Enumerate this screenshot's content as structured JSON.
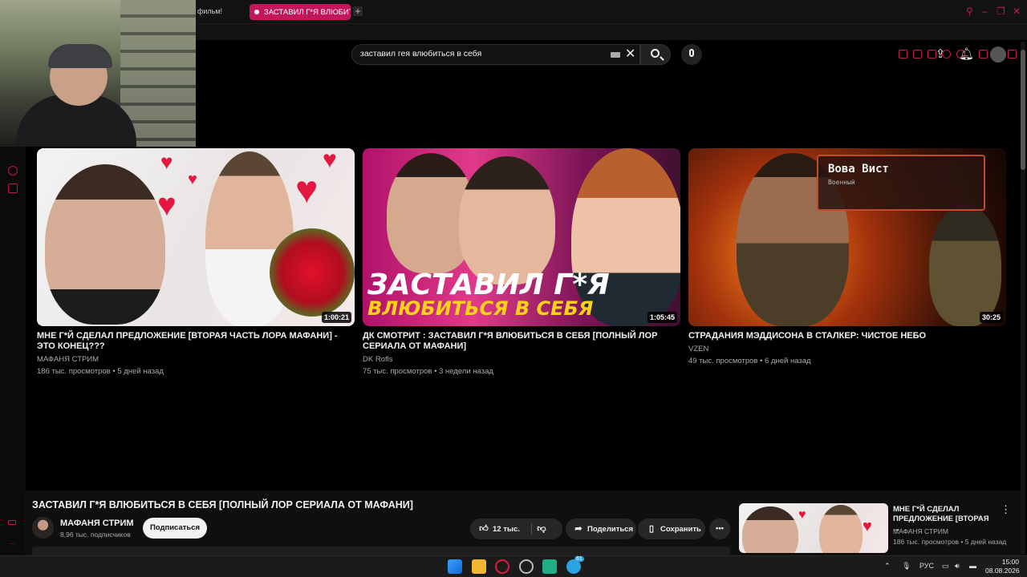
{
  "browser": {
    "prev_tab_label": "фильм!",
    "active_tab_label": "ЗАСТАВИЛ Г*Я ВЛЮБИТЬ",
    "accent_color": "#c2185b"
  },
  "header": {
    "search_value": "заставил гея влюбиться в себя",
    "icons": [
      "keyboard-icon",
      "clear-icon",
      "search-icon",
      "mic-icon",
      "upload-icon",
      "bell-icon",
      "avatar"
    ]
  },
  "videos": [
    {
      "title": "МНЕ Г*Й СДЕЛАЛ ПРЕДЛОЖЕНИЕ [ВТОРАЯ ЧАСТЬ ЛОРА МАФАНИ] - ЭТО КОНЕЦ???",
      "channel": "МАФАНЯ СТРИМ",
      "meta": "186 тыс. просмотров • 5 дней назад",
      "duration": "1:00:21"
    },
    {
      "title": "ДК СМОТРИТ : ЗАСТАВИЛ Г*Я ВЛЮБИТЬСЯ В СЕБЯ [ПОЛНЫЙ ЛОР СЕРИАЛА ОТ МАФАНИ]",
      "channel": "DK Rofls",
      "meta": "75 тыс. просмотров • 3 недели назад",
      "duration": "1:05:45",
      "thumb_text_line1": "ЗАСТАВИЛ Г*Я",
      "thumb_text_line2": "ВЛЮБИТЬСЯ В СЕБЯ"
    },
    {
      "title": "СТРАДАНИЯ МЭДДИСОНА В СТАЛКЕР: ЧИСТОЕ НЕБО",
      "channel": "VZEN",
      "meta": "49 тыс. просмотров • 6 дней назад",
      "duration": "30:25",
      "thumb_badge_name": "Вова Вист",
      "thumb_badge_sub": "Военный"
    }
  ],
  "player": {
    "title": "ЗАСТАВИЛ Г*Я ВЛЮБИТЬСЯ В СЕБЯ [ПОЛНЫЙ ЛОР СЕРИАЛА ОТ МАФАНИ]",
    "channel_name": "МАФАНЯ СТРИМ",
    "subscribers": "8,96 тыс. подписчиков",
    "subscribe_label": "Подписаться",
    "likes": "12 тыс.",
    "share_label": "Поделиться",
    "save_label": "Сохранить"
  },
  "up_next": {
    "title": "МНЕ Г*Й СДЕЛАЛ ПРЕДЛОЖЕНИЕ [ВТОРАЯ ...",
    "channel": "МАФАНЯ СТРИМ",
    "meta": "186 тыс. просмотров • 5 дней назад"
  },
  "taskbar": {
    "language": "РУС",
    "time": "15:00",
    "date": "08.08.2026",
    "telegram_badge": "61"
  }
}
